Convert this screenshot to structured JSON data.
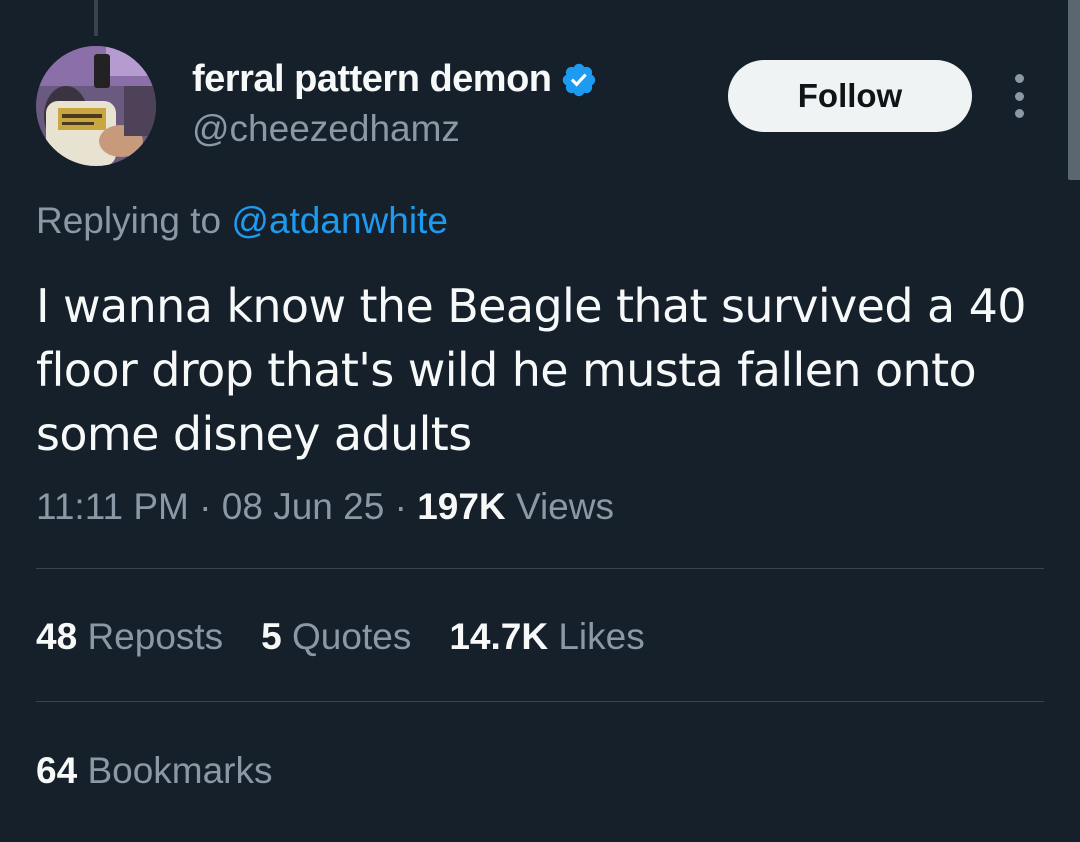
{
  "author": {
    "display_name": "ferral pattern demon",
    "handle": "@cheezedhamz",
    "verified": true
  },
  "follow_button": {
    "label": "Follow"
  },
  "more_icon": "more-horizontal-icon",
  "reply_context": {
    "prefix": "Replying to",
    "mention": "@atdanwhite"
  },
  "tweet": {
    "text": "I wanna know the Beagle that survived a 40 floor drop that's wild he musta fallen onto some disney adults"
  },
  "meta": {
    "time": "11:11 PM",
    "date": "08 Jun 25",
    "views_count": "197K",
    "views_label": "Views",
    "separator": "·"
  },
  "stats": {
    "reposts": {
      "count": "48",
      "label": "Reposts"
    },
    "quotes": {
      "count": "5",
      "label": "Quotes"
    },
    "likes": {
      "count": "14.7K",
      "label": "Likes"
    },
    "bookmarks": {
      "count": "64",
      "label": "Bookmarks"
    }
  },
  "colors": {
    "background": "#15202b",
    "primary_text": "#f7f9f9",
    "secondary_text": "#8b98a5",
    "accent": "#1d9bf0",
    "divider": "#38444d"
  }
}
